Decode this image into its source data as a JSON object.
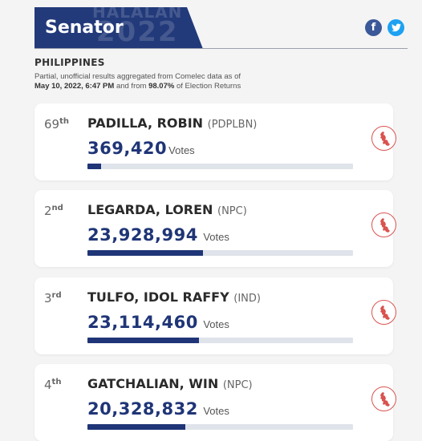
{
  "header": {
    "title": "Senator",
    "watermark_top": "HALALAN",
    "watermark_bottom": "2022",
    "brand_color": "#223a7a"
  },
  "share": {
    "facebook_icon": "facebook-icon",
    "twitter_icon": "twitter-icon"
  },
  "region": "PHILIPPINES",
  "note": {
    "prefix": "Partial, unofficial results aggregated from Comelec data as of",
    "date": "May 10, 2022, 6:47 PM",
    "middle": "and from",
    "percent": "98.07%",
    "suffix": "of Election Returns"
  },
  "candidates": [
    {
      "rank": "69",
      "rank_suffix": "th",
      "name": "PADILLA, ROBIN",
      "party": "(PDPLBN)",
      "votes": "369,420",
      "votes_label": "Votes",
      "bar_fraction": 0.05
    },
    {
      "rank": "2",
      "rank_suffix": "nd",
      "name": "LEGARDA, LOREN",
      "party": "(NPC)",
      "votes": "23,928,994",
      "votes_label": "Votes",
      "bar_fraction": 0.435
    },
    {
      "rank": "3",
      "rank_suffix": "rd",
      "name": "TULFO, IDOL RAFFY",
      "party": "(IND)",
      "votes": "23,114,460",
      "votes_label": "Votes",
      "bar_fraction": 0.42
    },
    {
      "rank": "4",
      "rank_suffix": "th",
      "name": "GATCHALIAN, WIN",
      "party": "(NPC)",
      "votes": "20,328,832",
      "votes_label": "Votes",
      "bar_fraction": 0.37
    }
  ],
  "map_icon": "philippines-map-icon",
  "colors": {
    "accent": "#1f3577",
    "map_icon": "#d9534f",
    "track": "#dfe3ea"
  }
}
